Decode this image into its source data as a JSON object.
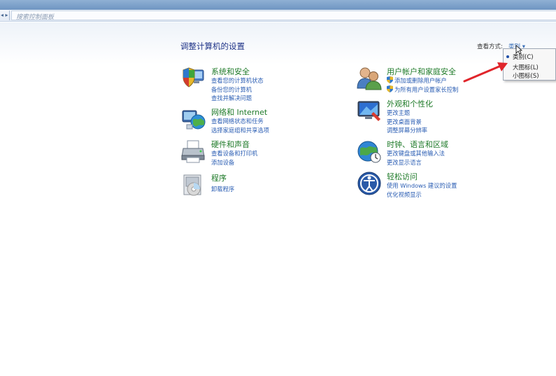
{
  "toolbar": {
    "nav_arrows": "◂ ▸",
    "search_placeholder": "搜索控制面板"
  },
  "page": {
    "title": "调整计算机的设置",
    "view_by_label": "查看方式:",
    "view_by_value": "类别 ▾"
  },
  "categories": [
    {
      "title": "系统和安全",
      "links": [
        "查看您的计算机状态",
        "备份您的计算机",
        "查找并解决问题"
      ]
    },
    {
      "title": "网络和 Internet",
      "links": [
        "查看网络状态和任务",
        "选择家庭组和共享选项"
      ]
    },
    {
      "title": "硬件和声音",
      "links": [
        "查看设备和打印机",
        "添加设备"
      ]
    },
    {
      "title": "程序",
      "links": [
        "卸载程序"
      ]
    },
    {
      "title": "用户帐户和家庭安全",
      "links": [
        "添加或删除用户帐户",
        "为所有用户设置家长控制"
      ]
    },
    {
      "title": "外观和个性化",
      "links": [
        "更改主题",
        "更改桌面背景",
        "调整屏幕分辨率"
      ]
    },
    {
      "title": "时钟、语言和区域",
      "links": [
        "更改键盘或其他输入法",
        "更改显示语言"
      ]
    },
    {
      "title": "轻松访问",
      "links": [
        "使用 Windows 建议的设置",
        "优化视频显示"
      ]
    }
  ],
  "dropdown": {
    "items": [
      "类别(C)",
      "大图标(L)",
      "小图标(S)"
    ],
    "selected_index": 0
  },
  "colors": {
    "title_green": "#1e7a28",
    "link_blue": "#2a5db3",
    "heading_blue": "#1e3287",
    "annotation_arrow": "#e0252b"
  },
  "icons": {
    "system_security": "shield-pc-icon",
    "network": "globe-network-icon",
    "hardware": "printer-icon",
    "programs": "programs-box-icon",
    "user_accounts": "users-icon",
    "appearance": "monitor-personalize-icon",
    "clock_region": "clock-globe-icon",
    "ease_of_access": "ease-of-access-icon"
  }
}
